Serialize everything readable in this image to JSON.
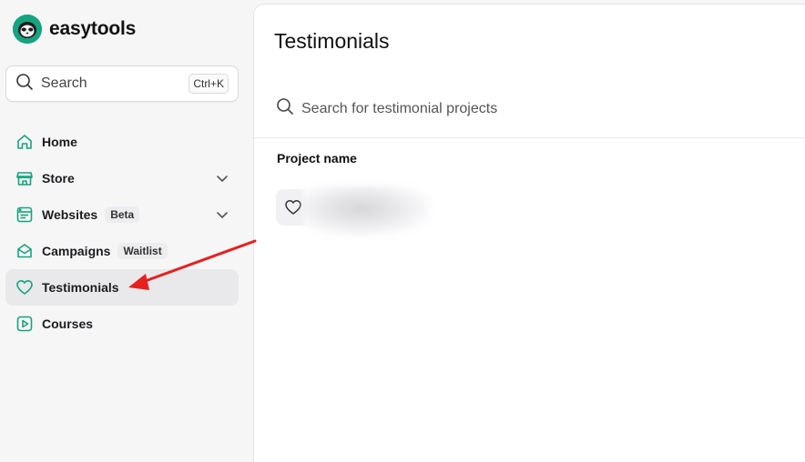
{
  "app": {
    "logo_text": "easytools",
    "brand_color": "#16a37f"
  },
  "sidebar": {
    "search": {
      "label": "Search",
      "shortcut": "Ctrl+K"
    },
    "items": [
      {
        "label": "Home",
        "icon": "home-icon"
      },
      {
        "label": "Store",
        "icon": "store-icon",
        "expandable": true
      },
      {
        "label": "Websites",
        "icon": "websites-icon",
        "badge": "Beta",
        "expandable": true
      },
      {
        "label": "Campaigns",
        "icon": "campaigns-icon",
        "badge": "Waitlist"
      },
      {
        "label": "Testimonials",
        "icon": "heart-icon",
        "active": true
      },
      {
        "label": "Courses",
        "icon": "courses-icon"
      }
    ]
  },
  "main": {
    "title": "Testimonials",
    "search_placeholder": "Search for testimonial projects",
    "columns": [
      "Project name"
    ],
    "projects": [
      {
        "icon": "heart-icon",
        "name_redacted": true
      }
    ]
  },
  "annotation": {
    "arrow_color": "#e8201e"
  }
}
